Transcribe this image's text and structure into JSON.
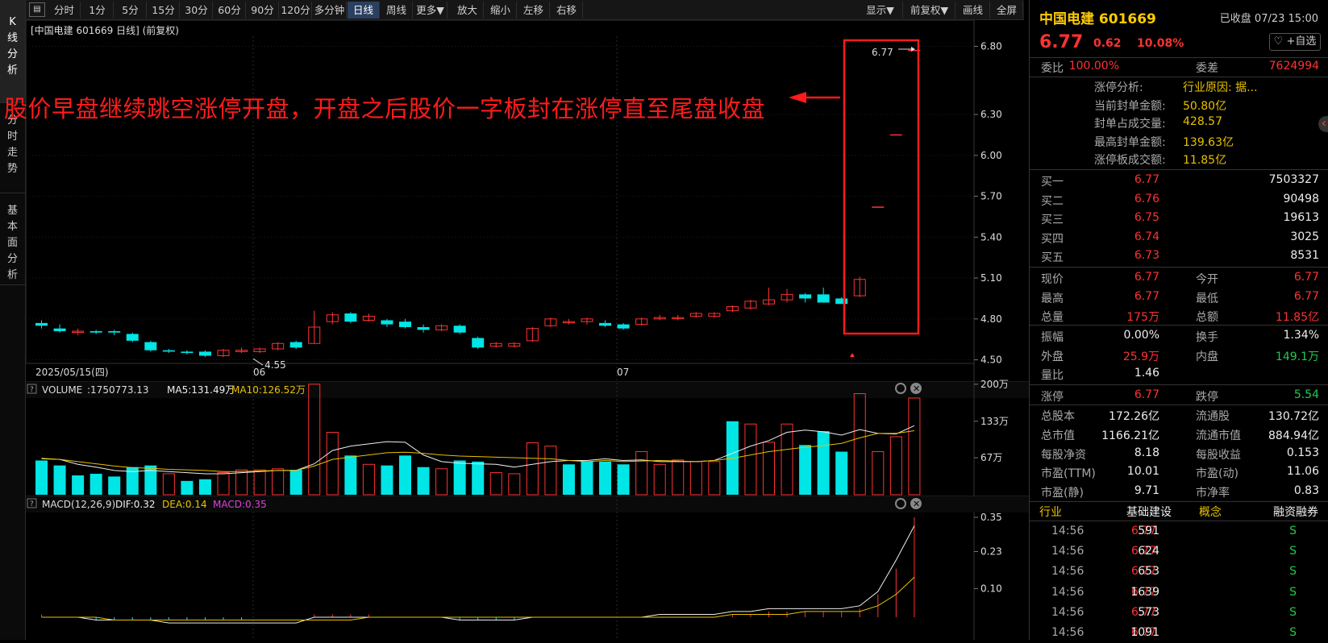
{
  "sidebar": {
    "tabs": [
      {
        "label": "K线分析",
        "chars": [
          "K",
          "线",
          "分",
          "析"
        ]
      },
      {
        "label": "分时走势",
        "chars": [
          "分",
          "时",
          "走",
          "势"
        ]
      },
      {
        "label": "基本面分析",
        "chars": [
          "基",
          "本",
          "面",
          "分",
          "析"
        ]
      }
    ]
  },
  "toolbar": {
    "menu_icon": "▤",
    "periods": [
      "分时",
      "1分",
      "5分",
      "15分",
      "30分",
      "60分",
      "90分",
      "120分",
      "多分钟",
      "日线",
      "周线",
      "更多▼"
    ],
    "active": "日线",
    "actions": [
      "放大",
      "缩小",
      "左移",
      "右移"
    ],
    "right": [
      "显示▼",
      "前复权▼",
      "画线",
      "全屏"
    ]
  },
  "chart": {
    "title": "[中国电建 601669 日线] (前复权)",
    "annotation": "股价早盘继续跳空涨停开盘，开盘之后股价一字板封在涨停直至尾盘收盘",
    "date_labels": [
      "2025/05/15(四)",
      "06",
      "07"
    ],
    "low_label": "4.55",
    "high_label": "6.77",
    "volume_legend": {
      "name": "VOLUME",
      "value": ":1750773.13",
      "ma5": "MA5:131.49万",
      "ma10": "MA10:126.52万"
    },
    "macd_legend": {
      "name": "MACD(12,26,9)",
      "dif": "DIF:0.32",
      "dea": "DEA:0.14",
      "macd": "MACD:0.35"
    },
    "panel_icons": [
      "help-icon",
      "gear-icon",
      "close-icon"
    ]
  },
  "chart_data": [
    {
      "type": "candlestick",
      "title": "中国电建 601669 日线 (前复权)",
      "y_ticks": [
        "6.80",
        "6.30",
        "6.00",
        "5.70",
        "5.40",
        "5.10",
        "4.80",
        "4.50"
      ],
      "x_ticks": [
        "2025/05/15(四)",
        "06",
        "07"
      ],
      "candles": [
        [
          4.77,
          4.75,
          4.79,
          4.73
        ],
        [
          4.73,
          4.71,
          4.76,
          4.7
        ],
        [
          4.71,
          4.71,
          4.73,
          4.68
        ],
        [
          4.71,
          4.7,
          4.72,
          4.69
        ],
        [
          4.71,
          4.7,
          4.72,
          4.68
        ],
        [
          4.69,
          4.64,
          4.7,
          4.63
        ],
        [
          4.63,
          4.57,
          4.64,
          4.56
        ],
        [
          4.57,
          4.56,
          4.58,
          4.55
        ],
        [
          4.56,
          4.55,
          4.57,
          4.54
        ],
        [
          4.56,
          4.53,
          4.57,
          4.52
        ],
        [
          4.53,
          4.57,
          4.58,
          4.52
        ],
        [
          4.56,
          4.57,
          4.59,
          4.55
        ],
        [
          4.56,
          4.58,
          4.59,
          4.55
        ],
        [
          4.58,
          4.62,
          4.63,
          4.57
        ],
        [
          4.63,
          4.59,
          4.64,
          4.58
        ],
        [
          4.62,
          4.74,
          4.86,
          4.62
        ],
        [
          4.78,
          4.83,
          4.85,
          4.76
        ],
        [
          4.84,
          4.78,
          4.85,
          4.77
        ],
        [
          4.79,
          4.82,
          4.84,
          4.78
        ],
        [
          4.79,
          4.76,
          4.8,
          4.74
        ],
        [
          4.78,
          4.74,
          4.8,
          4.73
        ],
        [
          4.74,
          4.72,
          4.76,
          4.7
        ],
        [
          4.72,
          4.75,
          4.76,
          4.71
        ],
        [
          4.75,
          4.7,
          4.76,
          4.69
        ],
        [
          4.66,
          4.59,
          4.67,
          4.58
        ],
        [
          4.6,
          4.62,
          4.63,
          4.59
        ],
        [
          4.6,
          4.62,
          4.63,
          4.59
        ],
        [
          4.64,
          4.73,
          4.74,
          4.63
        ],
        [
          4.75,
          4.8,
          4.81,
          4.74
        ],
        [
          4.78,
          4.78,
          4.8,
          4.76
        ],
        [
          4.78,
          4.8,
          4.81,
          4.76
        ],
        [
          4.77,
          4.75,
          4.79,
          4.74
        ],
        [
          4.76,
          4.73,
          4.77,
          4.72
        ],
        [
          4.76,
          4.8,
          4.81,
          4.75
        ],
        [
          4.8,
          4.81,
          4.83,
          4.79
        ],
        [
          4.81,
          4.81,
          4.83,
          4.79
        ],
        [
          4.82,
          4.84,
          4.85,
          4.81
        ],
        [
          4.82,
          4.84,
          4.85,
          4.81
        ],
        [
          4.86,
          4.89,
          4.9,
          4.85
        ],
        [
          4.88,
          4.93,
          4.94,
          4.87
        ],
        [
          4.91,
          4.94,
          5.03,
          4.9
        ],
        [
          4.94,
          4.98,
          5.02,
          4.92
        ],
        [
          4.98,
          4.95,
          4.99,
          4.92
        ],
        [
          4.98,
          4.92,
          5.03,
          4.92
        ],
        [
          4.95,
          4.91,
          4.96,
          4.91
        ],
        [
          4.97,
          5.09,
          5.11,
          4.96
        ],
        [
          5.62,
          5.62,
          5.62,
          5.62
        ],
        [
          6.15,
          6.15,
          6.15,
          6.15
        ],
        [
          6.77,
          6.77,
          6.77,
          6.77
        ]
      ]
    },
    {
      "type": "bar",
      "title": "VOLUME",
      "y_ticks": [
        "200万",
        "133万",
        "67万"
      ],
      "values_wan": [
        62,
        53,
        35,
        38,
        33,
        50,
        53,
        38,
        25,
        28,
        40,
        45,
        45,
        47,
        45,
        200,
        113,
        71,
        55,
        53,
        71,
        50,
        47,
        62,
        60,
        40,
        38,
        94,
        88,
        55,
        60,
        60,
        55,
        78,
        55,
        63,
        60,
        60,
        133,
        128,
        95,
        128,
        90,
        115,
        78,
        183,
        78,
        105,
        175
      ],
      "up": [
        false,
        false,
        false,
        false,
        false,
        false,
        false,
        true,
        false,
        false,
        true,
        true,
        true,
        true,
        false,
        true,
        true,
        false,
        true,
        false,
        false,
        false,
        true,
        false,
        false,
        true,
        true,
        true,
        true,
        false,
        false,
        false,
        false,
        true,
        true,
        true,
        true,
        true,
        false,
        true,
        true,
        true,
        false,
        false,
        false,
        true,
        true,
        true,
        true
      ],
      "ma5": [
        65,
        64,
        55,
        50,
        44,
        42,
        44,
        42,
        40,
        38,
        38,
        40,
        42,
        44,
        44,
        56,
        80,
        88,
        92,
        96,
        95,
        72,
        60,
        57,
        56,
        55,
        50,
        55,
        60,
        62,
        62,
        65,
        62,
        63,
        60,
        60,
        60,
        62,
        75,
        88,
        98,
        113,
        117,
        114,
        108,
        118,
        111,
        110,
        125
      ],
      "ma10": [
        66,
        64,
        60,
        56,
        52,
        49,
        48,
        46,
        45,
        44,
        42,
        42,
        43,
        44,
        44,
        52,
        64,
        68,
        72,
        76,
        77,
        75,
        72,
        70,
        69,
        68,
        67,
        66,
        65,
        62,
        60,
        62,
        60,
        61,
        62,
        61,
        60,
        62,
        66,
        72,
        78,
        82,
        86,
        89,
        93,
        103,
        111,
        111,
        116
      ]
    },
    {
      "type": "bar",
      "title": "MACD(12,26,9)",
      "y_ticks": [
        "0.35",
        "0.23",
        "0.10"
      ],
      "macd": [
        0.01,
        0.0,
        0.0,
        -0.01,
        -0.01,
        -0.01,
        -0.01,
        -0.01,
        -0.01,
        -0.01,
        -0.01,
        -0.01,
        0.0,
        0.0,
        0.0,
        0.01,
        0.01,
        0.01,
        0.01,
        0.0,
        0.0,
        0.0,
        0.0,
        -0.01,
        -0.01,
        -0.01,
        -0.01,
        0.0,
        0.0,
        0.0,
        0.0,
        0.0,
        0.0,
        0.0,
        0.0,
        0.0,
        0.0,
        0.0,
        0.01,
        0.01,
        0.02,
        0.02,
        0.02,
        0.02,
        0.02,
        0.03,
        0.08,
        0.17,
        0.35
      ],
      "dif": [
        0.0,
        0.0,
        0.0,
        -0.01,
        -0.01,
        -0.01,
        -0.01,
        -0.02,
        -0.02,
        -0.02,
        -0.02,
        -0.02,
        -0.02,
        -0.02,
        -0.02,
        0.0,
        0.0,
        0.0,
        0.0,
        0.0,
        0.0,
        0.0,
        0.0,
        -0.01,
        -0.01,
        -0.01,
        -0.01,
        0.0,
        0.0,
        0.0,
        0.0,
        0.0,
        0.0,
        0.0,
        0.01,
        0.01,
        0.01,
        0.01,
        0.02,
        0.02,
        0.03,
        0.03,
        0.03,
        0.03,
        0.03,
        0.04,
        0.09,
        0.2,
        0.32
      ],
      "dea": [
        0.0,
        0.0,
        0.0,
        0.0,
        -0.01,
        -0.01,
        -0.01,
        -0.01,
        -0.01,
        -0.01,
        -0.01,
        -0.01,
        -0.01,
        -0.01,
        -0.01,
        -0.01,
        -0.01,
        -0.01,
        0.0,
        0.0,
        0.0,
        0.0,
        0.0,
        0.0,
        0.0,
        0.0,
        0.0,
        0.0,
        0.0,
        0.0,
        0.0,
        0.0,
        0.0,
        0.0,
        0.0,
        0.0,
        0.0,
        0.0,
        0.01,
        0.01,
        0.01,
        0.01,
        0.02,
        0.02,
        0.02,
        0.02,
        0.04,
        0.08,
        0.14
      ]
    }
  ],
  "panel": {
    "name": "中国电建 601669",
    "close_status": "已收盘 07/23 15:00",
    "price": "6.77",
    "change": "0.62",
    "pct": "10.08%",
    "fav": "♡ +自选",
    "weibi": {
      "l1": "委比",
      "v1": "100.00%",
      "l2": "委差",
      "v2": "7624994"
    },
    "limit_info": [
      {
        "label": "涨停分析:",
        "value": "行业原因: 据..."
      },
      {
        "label": "当前封单金额:",
        "value": "50.80亿"
      },
      {
        "label": "封单占成交量:",
        "value": "428.57"
      },
      {
        "label": "最高封单金额:",
        "value": "139.63亿"
      },
      {
        "label": "涨停板成交额:",
        "value": "11.85亿"
      }
    ],
    "bids": [
      {
        "l": "买一",
        "p": "6.77",
        "v": "7503327"
      },
      {
        "l": "买二",
        "p": "6.76",
        "v": "90498"
      },
      {
        "l": "买三",
        "p": "6.75",
        "v": "19613"
      },
      {
        "l": "买四",
        "p": "6.74",
        "v": "3025"
      },
      {
        "l": "买五",
        "p": "6.73",
        "v": "8531"
      }
    ],
    "stats1": [
      {
        "l1": "现价",
        "v1": "6.77",
        "l2": "今开",
        "v2": "6.77"
      },
      {
        "l1": "最高",
        "v1": "6.77",
        "l2": "最低",
        "v2": "6.77"
      },
      {
        "l1": "总量",
        "v1": "175万",
        "l2": "总额",
        "v2": "11.85亿"
      }
    ],
    "stats2": [
      {
        "l1": "振幅",
        "v1": "0.00%",
        "l2": "换手",
        "v2": "1.34%"
      },
      {
        "l1": "外盘",
        "v1": "25.9万",
        "l2": "内盘",
        "v2": "149.1万"
      },
      {
        "l1": "量比",
        "v1": "1.46",
        "l2": "",
        "v2": ""
      }
    ],
    "limits": {
      "l1": "涨停",
      "v1": "6.77",
      "l2": "跌停",
      "v2": "5.54"
    },
    "fundamentals": [
      {
        "l1": "总股本",
        "v1": "172.26亿",
        "l2": "流通股",
        "v2": "130.72亿"
      },
      {
        "l1": "总市值",
        "v1": "1166.21亿",
        "l2": "流通市值",
        "v2": "884.94亿"
      },
      {
        "l1": "每股净资",
        "v1": "8.18",
        "l2": "每股收益",
        "v2": "0.153"
      },
      {
        "l1": "市盈(TTM)",
        "v1": "10.01",
        "l2": "市盈(动)",
        "v2": "11.06"
      },
      {
        "l1": "市盈(静)",
        "v1": "9.71",
        "l2": "市净率",
        "v2": "0.83"
      }
    ],
    "tags": [
      "行业",
      "基础建设",
      "概念",
      "融资融券"
    ],
    "ticks": [
      {
        "t": "14:56",
        "p": "6.77",
        "v": "591",
        "d": "S"
      },
      {
        "t": "14:56",
        "p": "6.77",
        "v": "624",
        "d": "S"
      },
      {
        "t": "14:56",
        "p": "6.77",
        "v": "653",
        "d": "S"
      },
      {
        "t": "14:56",
        "p": "6.77",
        "v": "1639",
        "d": "S"
      },
      {
        "t": "14:56",
        "p": "6.77",
        "v": "573",
        "d": "S"
      },
      {
        "t": "14:56",
        "p": "6.77",
        "v": "1091",
        "d": "S"
      }
    ],
    "collapse_icon": "‹"
  }
}
